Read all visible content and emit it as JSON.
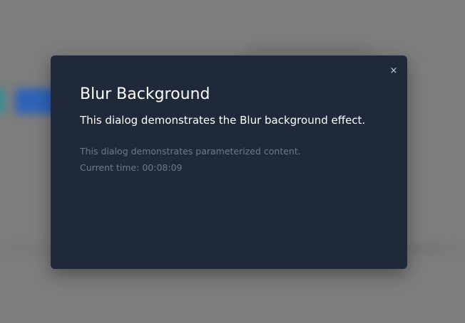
{
  "dialog": {
    "title": "Blur Background",
    "subtitle": "This dialog demonstrates the Blur background effect.",
    "body_line_1": "This dialog demonstrates parameterized content.",
    "body_line_2": "Current time: 00:08:09",
    "close_label": "×"
  },
  "colors": {
    "overlay": "#7d7d7d",
    "dialog_background": "#1f2939",
    "title_text": "#ffffff",
    "muted_text": "#6f7a89",
    "accent_blue": "#2f63b8",
    "accent_teal": "#2e8f9a"
  },
  "icons": {
    "close": "close-icon"
  }
}
